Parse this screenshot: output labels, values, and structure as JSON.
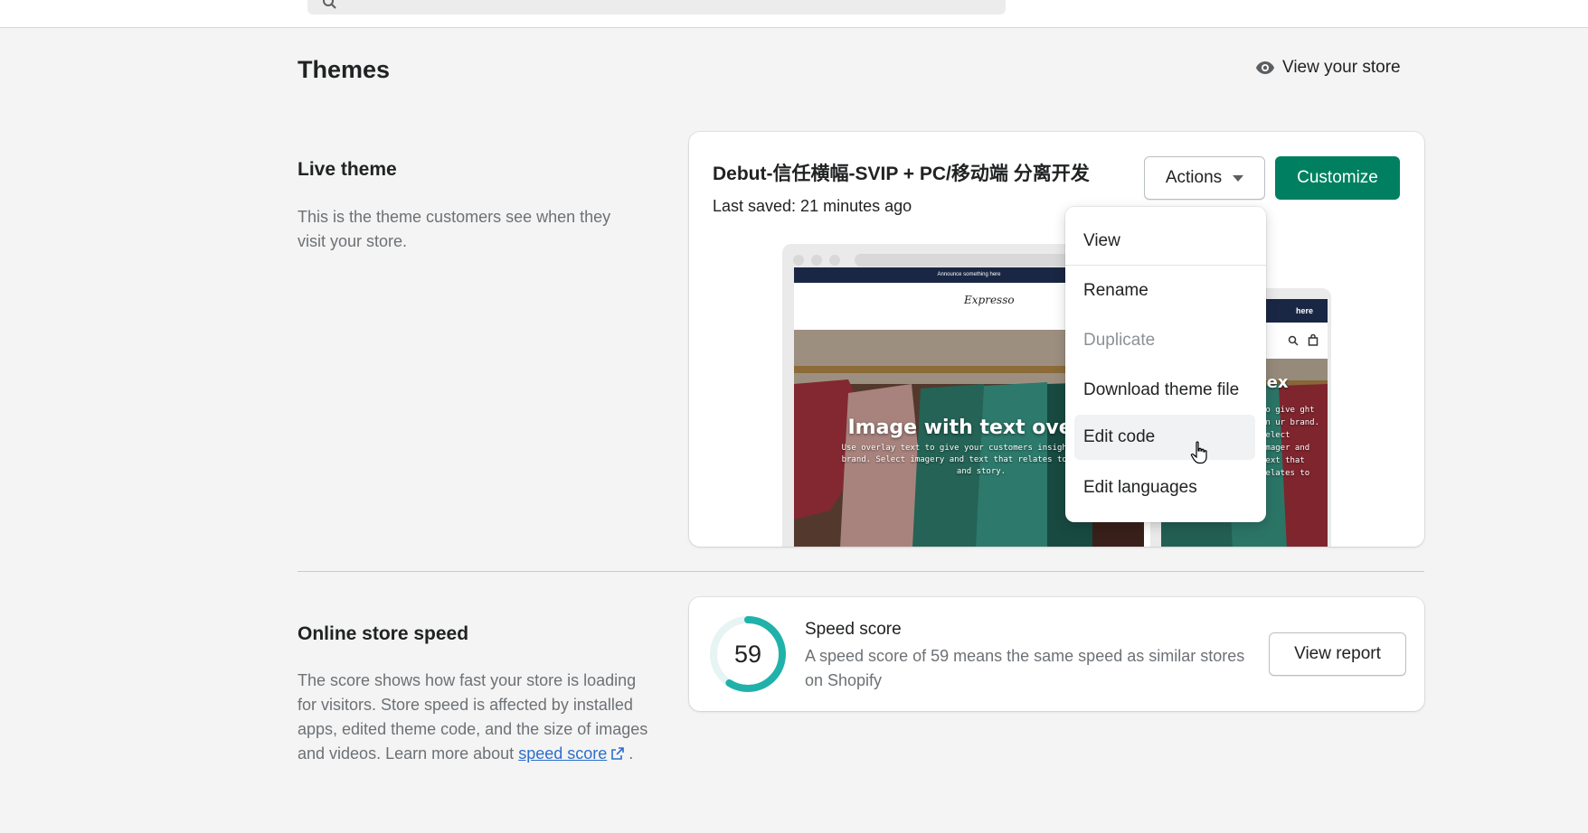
{
  "header": {
    "title": "Themes",
    "view_store": "View your store"
  },
  "live_theme": {
    "section_title": "Live theme",
    "section_desc": "This is the theme customers see when they visit your store.",
    "name": "Debut-信任横幅-SVIP + PC/移动端 分离开发",
    "last_saved": "Last saved: 21 minutes ago",
    "actions_label": "Actions",
    "customize_label": "Customize",
    "preview": {
      "announce": "Announce something here",
      "logo": "Expresso",
      "hero_heading": "Image with text overlay",
      "hero_text": "Use overlay text to give your customers insight into your brand. Select imagery and text that relates to your style and story.",
      "mobile_announce": "here",
      "mobile_heading": "tex",
      "mobile_text": "to give ght in ur brand. Select imager and text that relates to"
    }
  },
  "actions_menu": {
    "items": [
      {
        "label": "View"
      },
      {
        "label": "Rename"
      },
      {
        "label": "Duplicate"
      },
      {
        "label": "Download theme file"
      },
      {
        "label": "Edit code"
      },
      {
        "label": "Edit languages"
      }
    ]
  },
  "speed": {
    "section_title": "Online store speed",
    "desc_before": "The score shows how fast your store is loading for visitors. Store speed is affected by installed apps, edited theme code, and the size of images and videos. Learn more about",
    "link_label": "speed score",
    "desc_after": ".",
    "score": "59",
    "score_fraction": 0.59,
    "card_title": "Speed score",
    "card_desc": "A speed score of 59 means the same speed as similar stores on Shopify",
    "report_label": "View report"
  },
  "colors": {
    "accent": "#008060",
    "link": "#2c6ecb",
    "gauge": "#20b2aa"
  }
}
